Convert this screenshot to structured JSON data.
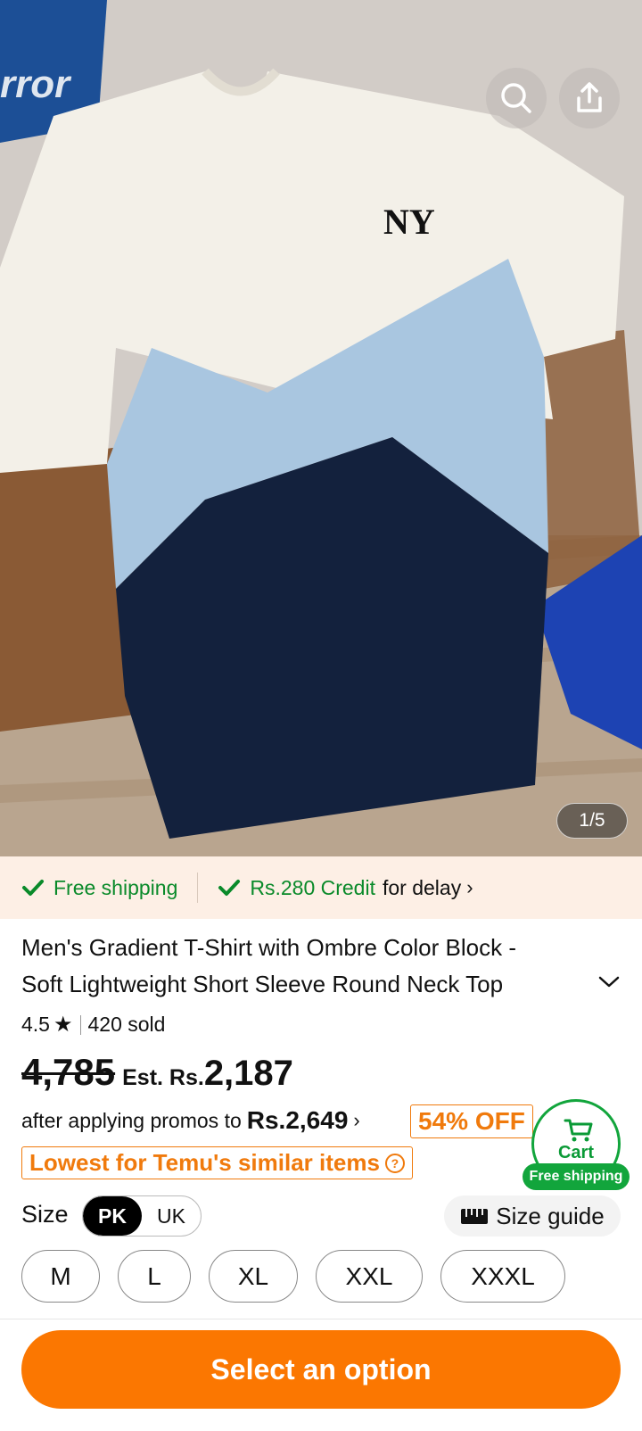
{
  "gallery": {
    "pager": "1/5",
    "logo_text": "rror"
  },
  "shipping_strip": {
    "free_shipping": "Free shipping",
    "credit_amount": "Rs.280 Credit",
    "credit_suffix": "for delay"
  },
  "product": {
    "title_line1": "Men's Gradient T-Shirt with Ombre Color Block -",
    "title_line2": "Soft Lightweight Short Sleeve Round Neck Top",
    "rating": "4.5",
    "sold": "420 sold"
  },
  "price": {
    "original": "4,785",
    "est_label": "Est. Rs.",
    "estimated": "2,187",
    "promo_prefix": "after applying promos to",
    "promo_price": "Rs.2,649",
    "discount": "54% OFF",
    "lowest_badge": "Lowest for Temu's similar items"
  },
  "cart": {
    "label": "Cart",
    "shipping": "Free shipping"
  },
  "size": {
    "label": "Size",
    "region_options": [
      "PK",
      "UK"
    ],
    "selected_region": "PK",
    "guide_label": "Size guide",
    "options": [
      "M",
      "L",
      "XL",
      "XXL",
      "XXXL"
    ]
  },
  "cta": {
    "label": "Select an option"
  },
  "colors": {
    "accent_orange": "#fb7701",
    "shipping_green": "#0a8a2a",
    "shirt_white": "#f3f0e8",
    "shirt_light_blue": "#a9c6e0",
    "shirt_navy": "#13213d"
  }
}
